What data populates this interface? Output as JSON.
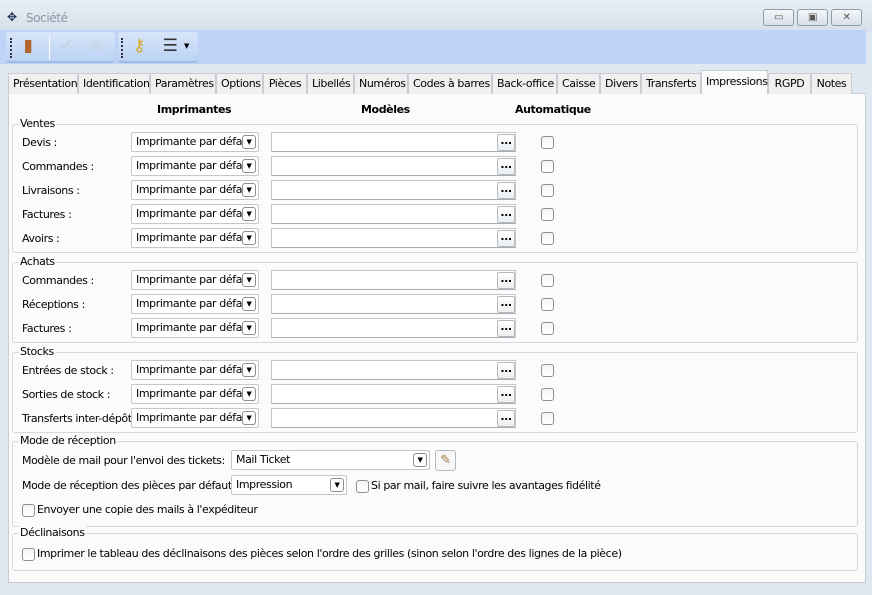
{
  "window": {
    "title": "Société",
    "logo": "xl-logo",
    "controls": [
      "minimize",
      "maximize",
      "close"
    ]
  },
  "toolbar": {
    "buttons": [
      {
        "name": "door-exit-icon",
        "enabled": true
      },
      {
        "name": "check-icon",
        "enabled": false
      },
      {
        "name": "cancel-icon",
        "enabled": false
      },
      {
        "name": "key-icon",
        "enabled": true
      },
      {
        "name": "report-menu-icon",
        "enabled": true
      }
    ]
  },
  "tabs": [
    "Présentation",
    "Identification",
    "Paramètres",
    "Options",
    "Pièces",
    "Libellés",
    "Numéros",
    "Codes à barres",
    "Back-office",
    "Caisse",
    "Divers",
    "Transferts",
    "Impressions",
    "RGPD",
    "Notes"
  ],
  "active_tab": "Impressions",
  "headers": {
    "printers": "Imprimantes",
    "models": "Modèles",
    "auto": "Automatique"
  },
  "groups": [
    {
      "title": "Ventes",
      "rows": [
        {
          "label": "Devis :",
          "printer": "Imprimante par défaut",
          "model": "",
          "auto": false
        },
        {
          "label": "Commandes :",
          "printer": "Imprimante par défaut",
          "model": "",
          "auto": false
        },
        {
          "label": "Livraisons :",
          "printer": "Imprimante par défaut",
          "model": "",
          "auto": false
        },
        {
          "label": "Factures :",
          "printer": "Imprimante par défaut",
          "model": "",
          "auto": false
        },
        {
          "label": "Avoirs :",
          "printer": "Imprimante par défaut",
          "model": "",
          "auto": false
        }
      ]
    },
    {
      "title": "Achats",
      "rows": [
        {
          "label": "Commandes :",
          "printer": "Imprimante par défaut",
          "model": "",
          "auto": false
        },
        {
          "label": "Réceptions :",
          "printer": "Imprimante par défaut",
          "model": "",
          "auto": false
        },
        {
          "label": "Factures :",
          "printer": "Imprimante par défaut",
          "model": "",
          "auto": false
        }
      ]
    },
    {
      "title": "Stocks",
      "rows": [
        {
          "label": "Entrées de stock :",
          "printer": "Imprimante par défaut",
          "model": "",
          "auto": false
        },
        {
          "label": "Sorties de stock :",
          "printer": "Imprimante par défaut",
          "model": "",
          "auto": false
        },
        {
          "label": "Transferts inter-dépôts :",
          "printer": "Imprimante par défaut",
          "model": "",
          "auto": false
        }
      ]
    }
  ],
  "browse_label": "...",
  "reception": {
    "title": "Mode de réception",
    "mail_model_label": "Modèle de mail pour l'envoi des tickets:",
    "mail_model_value": "Mail Ticket",
    "default_mode_label": "Mode de réception des pièces par défaut:",
    "default_mode_value": "Impression",
    "loyalty_label": "Si par mail, faire suivre les avantages fidélité",
    "loyalty_checked": false,
    "copy_label": "Envoyer une copie des mails à l'expéditeur",
    "copy_checked": false
  },
  "declinaisons": {
    "title": "Déclinaisons",
    "print_label": "Imprimer le tableau des déclinaisons des pièces selon l'ordre des grilles (sinon selon l'ordre des lignes de la pièce)",
    "print_checked": false
  }
}
